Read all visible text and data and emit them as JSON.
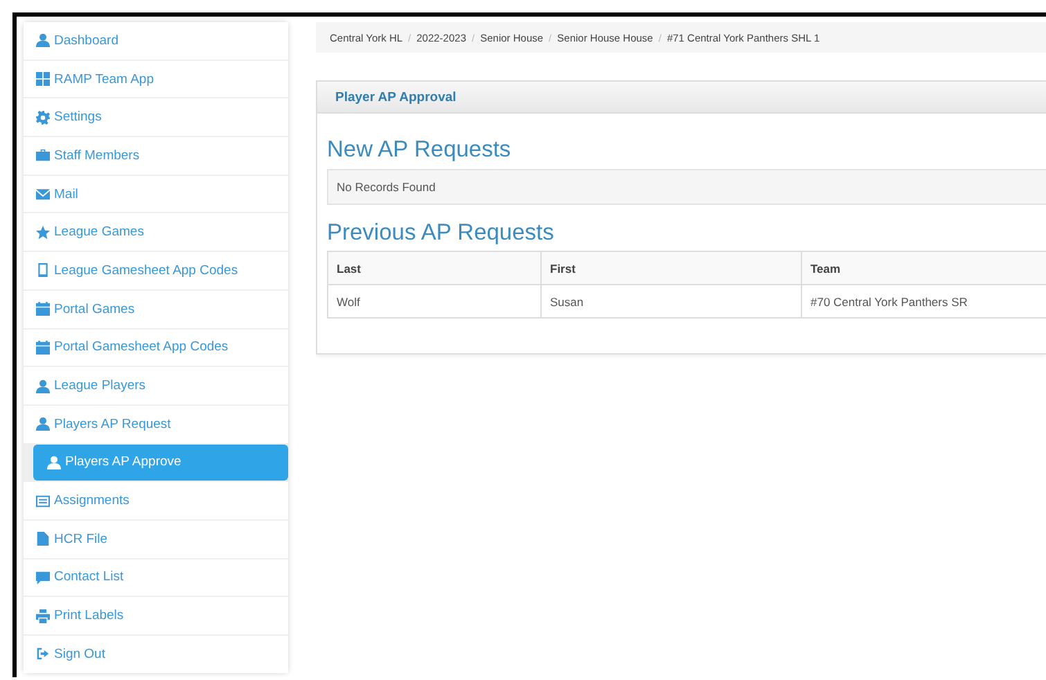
{
  "sidebar": {
    "items": [
      {
        "label": "Dashboard",
        "selected": false
      },
      {
        "label": "RAMP Team App",
        "selected": false
      },
      {
        "label": "Settings",
        "selected": false
      },
      {
        "label": "Staff Members",
        "selected": false
      },
      {
        "label": "Mail",
        "selected": false
      },
      {
        "label": "League Games",
        "selected": false
      },
      {
        "label": "League Gamesheet App Codes",
        "selected": false
      },
      {
        "label": "Portal Games",
        "selected": false
      },
      {
        "label": "Portal Gamesheet App Codes",
        "selected": false
      },
      {
        "label": "League Players",
        "selected": false
      },
      {
        "label": "Players AP Request",
        "selected": false
      },
      {
        "label": "Players AP Approve",
        "selected": true
      },
      {
        "label": "Assignments",
        "selected": false
      },
      {
        "label": "HCR File",
        "selected": false
      },
      {
        "label": "Contact List",
        "selected": false
      },
      {
        "label": "Print Labels",
        "selected": false
      },
      {
        "label": "Sign Out",
        "selected": false
      }
    ]
  },
  "breadcrumb_separator": "/",
  "breadcrumb": [
    "Central York HL",
    "2022-2023",
    "Senior House",
    "Senior House House",
    "#71 Central York Panthers SHL 1"
  ],
  "panel": {
    "title": "Player AP Approval",
    "new_requests": {
      "heading": "New AP Requests",
      "empty_message": "No Records Found"
    },
    "previous_requests": {
      "heading": "Previous AP Requests",
      "columns": [
        "Last",
        "First",
        "Team"
      ],
      "rows": [
        [
          "Wolf",
          "Susan",
          "#70 Central York Panthers SR"
        ]
      ]
    }
  }
}
